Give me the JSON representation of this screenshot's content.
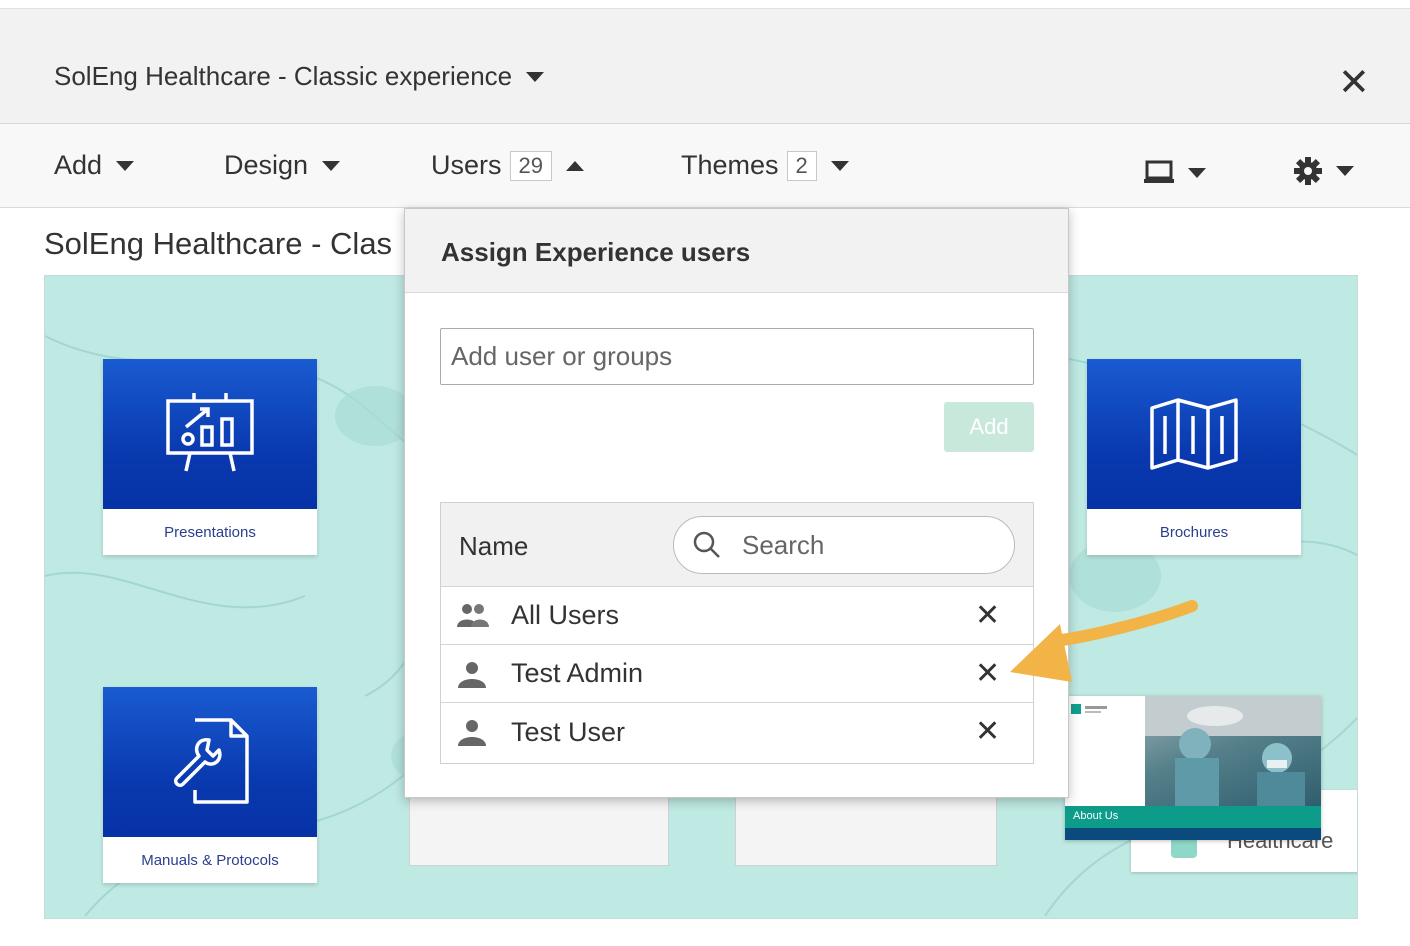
{
  "header": {
    "experience_title": "SolEng Healthcare - Classic experience",
    "close_label": "✕"
  },
  "menubar": {
    "add": "Add",
    "design": "Design",
    "users": "Users",
    "users_count": "29",
    "themes": "Themes",
    "themes_count": "2"
  },
  "page": {
    "title": "SolEng Healthcare - Clas"
  },
  "tiles": [
    {
      "label": "Presentations",
      "icon": "presentation-chart-icon"
    },
    {
      "label": "Brochures",
      "icon": "map-icon"
    },
    {
      "label": "Manuals & Protocols",
      "icon": "document-wrench-icon"
    }
  ],
  "preview": {
    "about_label": "About Us",
    "healthcare_text": "Healthcare"
  },
  "popover": {
    "title": "Assign Experience users",
    "input_placeholder": "Add user or groups",
    "add_button": "Add",
    "table_header": "Name",
    "search_placeholder": "Search",
    "rows": [
      {
        "name": "All Users",
        "icon": "group-icon",
        "remove": "✕"
      },
      {
        "name": "Test Admin",
        "icon": "user-icon",
        "remove": "✕"
      },
      {
        "name": "Test User",
        "icon": "user-icon",
        "remove": "✕"
      }
    ]
  },
  "colors": {
    "accent_arrow": "#f2b347",
    "tile_blue": "#0a3ab0",
    "canvas_teal": "#bfe9e3",
    "add_button_disabled": "#c9e8dc"
  }
}
